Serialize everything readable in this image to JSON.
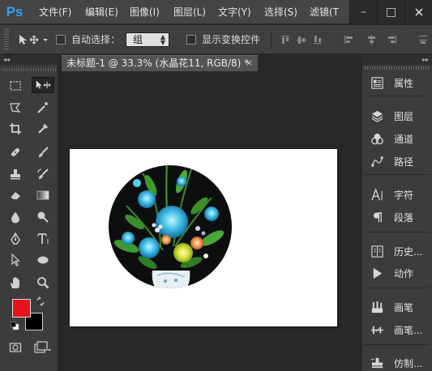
{
  "app": {
    "logo": "Ps"
  },
  "menu": {
    "items": [
      "文件(F)",
      "编辑(E)",
      "图像(I)",
      "图层(L)",
      "文字(Y)",
      "选择(S)",
      "滤镜(T"
    ]
  },
  "window_controls": {
    "minimize": "–",
    "maximize": "□"
  },
  "options_bar": {
    "auto_select_label": "自动选择：",
    "auto_select_checked": false,
    "group_select_value": "组",
    "show_transform_label": "显示变换控件",
    "show_transform_checked": false
  },
  "document": {
    "tab_title": "未标题-1 @ 33.3% (水晶花11, RGB/8) *",
    "close_glyph": "×",
    "canvas_color": "#ffffff"
  },
  "panel_headers": {
    "collapse_left": "◂◂",
    "collapse_right": "▸▸"
  },
  "tools": [
    "rectangular-marquee",
    "move",
    "lasso",
    "magic-wand",
    "crop",
    "eyedropper",
    "spot-healing-brush",
    "brush",
    "clone-stamp",
    "history-brush",
    "eraser",
    "gradient",
    "blur",
    "dodge",
    "pen",
    "horizontal-type",
    "path-selection",
    "ellipse",
    "hand",
    "zoom"
  ],
  "colors": {
    "foreground": "#e8121b",
    "background": "#000000",
    "accent": "#30a3f2"
  },
  "dock": {
    "items": [
      {
        "icon": "properties-icon",
        "label": "属性"
      },
      {
        "icon": "layers-icon",
        "label": "图层"
      },
      {
        "icon": "channels-icon",
        "label": "通道"
      },
      {
        "icon": "paths-icon",
        "label": "路径"
      },
      {
        "icon": "character-icon",
        "label": "字符"
      },
      {
        "icon": "paragraph-icon",
        "label": "段落"
      },
      {
        "icon": "history-icon",
        "label": "历史..."
      },
      {
        "icon": "actions-icon",
        "label": "动作"
      },
      {
        "icon": "brush-presets-icon",
        "label": "画笔"
      },
      {
        "icon": "brush-panel-icon",
        "label": "画笔..."
      },
      {
        "icon": "clone-source-icon",
        "label": "仿制..."
      }
    ]
  }
}
